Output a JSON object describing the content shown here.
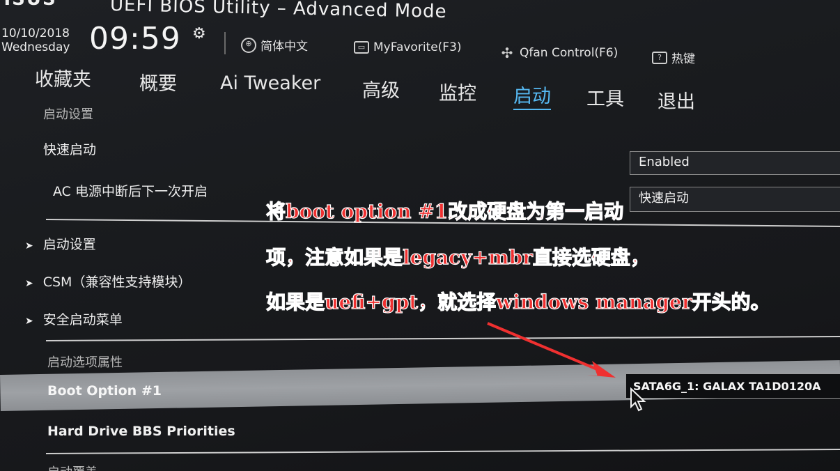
{
  "header": {
    "logo": "/ISUS",
    "title": "UEFI BIOS Utility – Advanced Mode",
    "date": "10/10/2018",
    "weekday": "Wednesday",
    "time": "09:59"
  },
  "toolbar": {
    "language": "简体中文",
    "myfavorite": "MyFavorite(F3)",
    "qfan": "Qfan Control(F6)",
    "hotkeys": "热键"
  },
  "tabs": [
    {
      "label": "收藏夹"
    },
    {
      "label": "概要"
    },
    {
      "label": "Ai Tweaker"
    },
    {
      "label": "高级"
    },
    {
      "label": "监控"
    },
    {
      "label": "启动",
      "active": true
    },
    {
      "label": "工具"
    },
    {
      "label": "退出"
    }
  ],
  "content": {
    "boot_settings_header": "启动设置",
    "fast_boot_label": "快速启动",
    "fast_boot_value": "Enabled",
    "ac_power_label": "AC 电源中断后下一次开启",
    "ac_power_value": "快速启动",
    "submenus": [
      {
        "label": "启动设置"
      },
      {
        "label": "CSM（兼容性支持模块）"
      },
      {
        "label": "安全启动菜单"
      }
    ],
    "boot_options_header": "启动选项属性",
    "boot_option_1_label": "Boot Option #1",
    "boot_option_1_value": "SATA6G_1: GALAX TA1D0120A",
    "hdd_bbs_label": "Hard Drive BBS Priorities",
    "bottom_partial_label": "启动覆盖"
  },
  "annotation": {
    "line1": "将boot option #1改成硬盘为第一启动",
    "line2": "项，注意如果是legacy+mbr直接选硬盘，",
    "line3": "如果是uefi+gpt，就选择windows manager开头的。",
    "color": "#ef3030"
  },
  "colors": {
    "background": "#1b1d20",
    "accent": "#56b9f2",
    "highlight_row": "#9a9da1",
    "annotation": "#ef3030"
  },
  "icons": [
    "gear-icon",
    "globe-icon",
    "favorite-icon",
    "fan-icon",
    "help-icon",
    "chevron-right-icon",
    "mouse-cursor-icon",
    "arrow-annotation"
  ]
}
